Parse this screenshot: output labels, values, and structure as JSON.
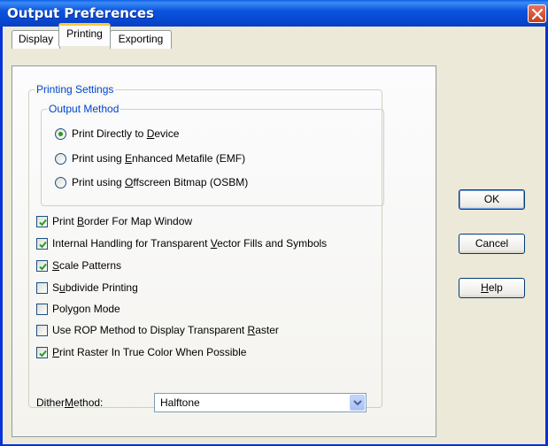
{
  "window": {
    "title": "Output Preferences",
    "close_icon": "close-icon"
  },
  "tabs": [
    {
      "label": "Display",
      "active": false
    },
    {
      "label": "Printing",
      "active": true
    },
    {
      "label": "Exporting",
      "active": false
    }
  ],
  "printing_settings": {
    "title": "Printing Settings",
    "output_method": {
      "title": "Output Method",
      "options": [
        {
          "pre": "Print Directly to ",
          "u": "D",
          "post": "evice",
          "selected": true
        },
        {
          "pre": "Print using ",
          "u": "E",
          "post": "nhanced Metafile (EMF)",
          "selected": false
        },
        {
          "pre": "Print using ",
          "u": "O",
          "post": "ffscreen Bitmap (OSBM)",
          "selected": false
        }
      ]
    },
    "options": [
      {
        "pre": "Print ",
        "u": "B",
        "post": "order For Map Window",
        "checked": true
      },
      {
        "pre": "Internal Handling for Transparent ",
        "u": "V",
        "post": "ector Fills and Symbols",
        "checked": true
      },
      {
        "pre": "",
        "u": "S",
        "post": "cale Patterns",
        "checked": true
      },
      {
        "pre": "S",
        "u": "u",
        "post": "bdivide Printing",
        "checked": false
      },
      {
        "pre": "Polygon Mode",
        "u": "",
        "post": "",
        "checked": false
      },
      {
        "pre": "Use ROP Method to Display Transparent ",
        "u": "R",
        "post": "aster",
        "checked": false
      },
      {
        "pre": "",
        "u": "P",
        "post": "rint Raster In True Color When Possible",
        "checked": true
      }
    ],
    "dither_method": {
      "label_pre": "Dither ",
      "label_u": "M",
      "label_post": "ethod:",
      "value": "Halftone"
    }
  },
  "buttons": {
    "ok": "OK",
    "cancel": "Cancel",
    "help_u": "H",
    "help_post": "elp"
  },
  "colors": {
    "titlebar": "#0a5ee8",
    "group_title": "#0046d5",
    "radio_on": "#21a121",
    "check_mark": "#21a121",
    "close_button": "#d2532f"
  }
}
